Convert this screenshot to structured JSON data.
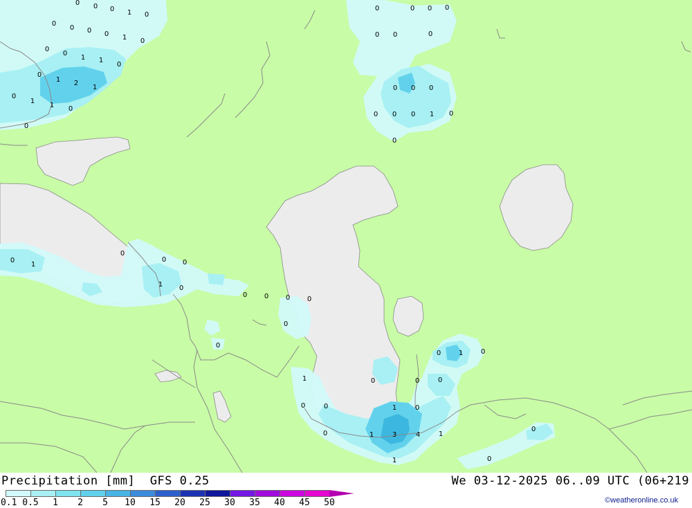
{
  "title": {
    "left": "Precipitation [mm]  GFS 0.25",
    "right": "We 03-12-2025 06..09 UTC (06+219"
  },
  "credit": "©weatheronline.co.uk",
  "colors": {
    "land": "#c8fca6",
    "water": "#ececec",
    "border": "#9a9a9a",
    "precip_light": "#d2fafa",
    "precip_mid": "#a8f0f4",
    "precip_heavy": "#62d2ec",
    "precip_max": "#3cb8e0"
  },
  "legend": {
    "labels": [
      "0.1",
      "0.5",
      "1",
      "2",
      "5",
      "10",
      "15",
      "20",
      "25",
      "30",
      "35",
      "40",
      "45",
      "50"
    ],
    "colors": [
      "#d2fafa",
      "#a8f0f4",
      "#80e4f0",
      "#60d0ec",
      "#48b4e4",
      "#3c8cdc",
      "#2c60cc",
      "#1c34b4",
      "#10189c",
      "#7418e4",
      "#a00cdc",
      "#cc08e0",
      "#e408d0",
      "#b400b0"
    ]
  },
  "map_values": {
    "north_west": [
      "0",
      "0",
      "0",
      "1",
      "0",
      "0",
      "0",
      "0",
      "0",
      "1",
      "0",
      "0",
      "0",
      "1",
      "1",
      "0",
      "0",
      "1",
      "2",
      "1",
      "0",
      "1",
      "1",
      "0",
      "0"
    ],
    "north_center": [
      "0",
      "0",
      "0",
      "0",
      "0",
      "0",
      "0",
      "0",
      "0",
      "0",
      "0",
      "0",
      "0",
      "1",
      "0",
      "0"
    ],
    "black_sea_area": [
      "0",
      "1",
      "0",
      "0",
      "0",
      "1",
      "0",
      "0",
      "0",
      "0",
      "0",
      "0",
      "0"
    ],
    "south_caspian": [
      "1",
      "0",
      "0",
      "0",
      "0",
      "0",
      "1",
      "0",
      "0",
      "1",
      "3",
      "4",
      "1",
      "1",
      "0",
      "1",
      "0",
      "0"
    ]
  }
}
